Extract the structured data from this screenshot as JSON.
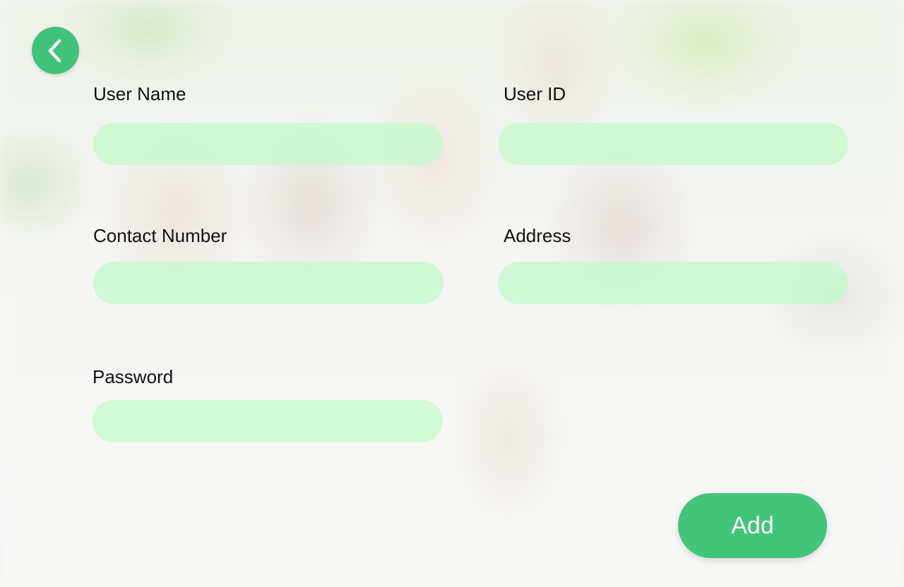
{
  "colors": {
    "accent": "#43c47b",
    "input_fill": "#c1fac8",
    "label_text": "#111111"
  },
  "header": {
    "back_icon": "chevron-left-icon"
  },
  "form": {
    "user_name": {
      "label": "User Name",
      "value": ""
    },
    "user_id": {
      "label": "User ID",
      "value": ""
    },
    "contact_number": {
      "label": "Contact Number",
      "value": ""
    },
    "address": {
      "label": "Address",
      "value": ""
    },
    "password": {
      "label": "Password",
      "value": ""
    }
  },
  "actions": {
    "add_label": "Add"
  }
}
